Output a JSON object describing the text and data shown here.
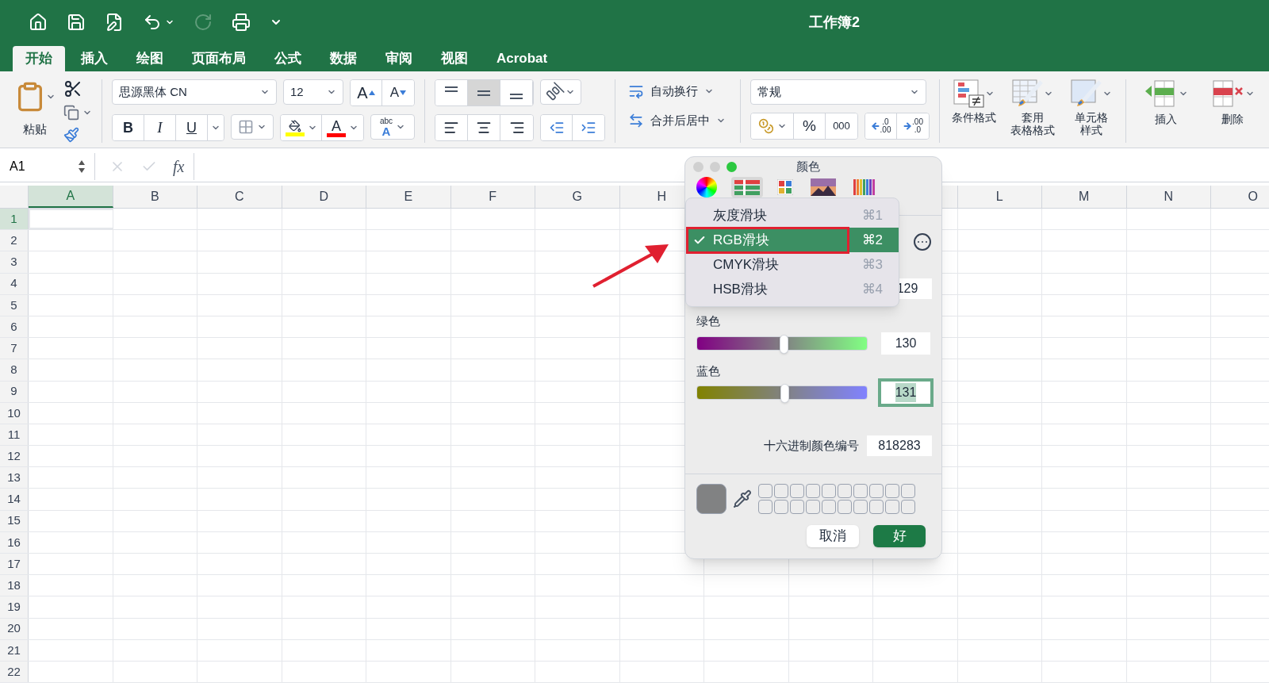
{
  "window": {
    "title": "工作簿2"
  },
  "ribbon_tabs": [
    {
      "label": "开始",
      "selected": true
    },
    {
      "label": "插入",
      "selected": false
    },
    {
      "label": "绘图",
      "selected": false
    },
    {
      "label": "页面布局",
      "selected": false
    },
    {
      "label": "公式",
      "selected": false
    },
    {
      "label": "数据",
      "selected": false
    },
    {
      "label": "审阅",
      "selected": false
    },
    {
      "label": "视图",
      "selected": false
    },
    {
      "label": "Acrobat",
      "selected": false
    }
  ],
  "clipboard": {
    "paste_label": "粘贴"
  },
  "font": {
    "family": "思源黑体 CN",
    "size": "12",
    "grow_label": "A",
    "shrink_label": "A",
    "bold_label": "B",
    "italic_label": "I",
    "underline_label": "U",
    "font_color_label": "A",
    "effects_small": "abc",
    "effects_large": "A"
  },
  "alignment": {
    "vertical": [
      {
        "selected": false
      },
      {
        "selected": true
      },
      {
        "selected": false
      }
    ]
  },
  "wrap": {
    "wrap_label": "自动换行",
    "merge_label": "合并后居中"
  },
  "number": {
    "format": "常规",
    "percent": "%",
    "thousands": "000",
    "increase_decimal": [
      ".0",
      ".00"
    ],
    "decrease_decimal": [
      ".00",
      ".0"
    ]
  },
  "styles": [
    {
      "kind": "conditional",
      "lines": [
        "条件格式"
      ]
    },
    {
      "kind": "table",
      "lines": [
        "套用",
        "表格格式"
      ]
    },
    {
      "kind": "cell",
      "lines": [
        "单元格",
        "样式"
      ]
    }
  ],
  "cells": [
    {
      "kind": "insert",
      "label": "插入"
    },
    {
      "kind": "delete",
      "label": "删除"
    }
  ],
  "formula_bar": {
    "name_box": "A1",
    "function_label": "fx"
  },
  "sheet": {
    "columns_left": [
      {
        "label": "A",
        "selected": true
      },
      {
        "label": "B",
        "selected": false
      },
      {
        "label": "C",
        "selected": false
      },
      {
        "label": "D",
        "selected": false
      },
      {
        "label": "E",
        "selected": false
      },
      {
        "label": "F",
        "selected": false
      },
      {
        "label": "G",
        "selected": false
      },
      {
        "label": "H",
        "selected": false
      }
    ],
    "columns_right": [
      {
        "label": "L",
        "selected": false
      },
      {
        "label": "M",
        "selected": false
      },
      {
        "label": "N",
        "selected": false
      },
      {
        "label": "O",
        "selected": false
      }
    ],
    "rows": [
      {
        "label": "1",
        "selected": true
      },
      {
        "label": "2",
        "selected": false
      },
      {
        "label": "3",
        "selected": false
      },
      {
        "label": "4",
        "selected": false
      },
      {
        "label": "5",
        "selected": false
      },
      {
        "label": "6",
        "selected": false
      },
      {
        "label": "7",
        "selected": false
      },
      {
        "label": "8",
        "selected": false
      },
      {
        "label": "9",
        "selected": false
      },
      {
        "label": "10",
        "selected": false
      },
      {
        "label": "11",
        "selected": false
      },
      {
        "label": "12",
        "selected": false
      },
      {
        "label": "13",
        "selected": false
      },
      {
        "label": "14",
        "selected": false
      },
      {
        "label": "15",
        "selected": false
      },
      {
        "label": "16",
        "selected": false
      },
      {
        "label": "17",
        "selected": false
      },
      {
        "label": "18",
        "selected": false
      },
      {
        "label": "19",
        "selected": false
      },
      {
        "label": "20",
        "selected": false
      },
      {
        "label": "21",
        "selected": false
      },
      {
        "label": "22",
        "selected": false
      }
    ]
  },
  "color_dialog": {
    "title": "颜色",
    "modes": [
      {
        "kind": "wheel",
        "selected": false
      },
      {
        "kind": "sliders",
        "selected": true
      },
      {
        "kind": "palettes",
        "selected": false
      },
      {
        "kind": "image",
        "selected": false
      },
      {
        "kind": "pencils",
        "selected": false
      }
    ],
    "slider_menu": [
      {
        "label": "灰度滑块",
        "shortcut": "⌘1",
        "selected": false
      },
      {
        "label": "RGB滑块",
        "shortcut": "⌘2",
        "selected": true
      },
      {
        "label": "CMYK滑块",
        "shortcut": "⌘3",
        "selected": false
      },
      {
        "label": "HSB滑块",
        "shortcut": "⌘4",
        "selected": false
      }
    ],
    "red_value": "129",
    "sliders": [
      {
        "kind": "green",
        "label": "绿色",
        "level": 0.51,
        "value": "130",
        "focused": false
      },
      {
        "kind": "blue",
        "label": "蓝色",
        "level": 0.514,
        "value": "131",
        "focused": true
      }
    ],
    "hex_label": "十六进制颜色编号",
    "hex_value": "818283",
    "buttons": [
      {
        "kind": "secondary",
        "label": "取消"
      },
      {
        "kind": "primary",
        "label": "好"
      }
    ]
  }
}
